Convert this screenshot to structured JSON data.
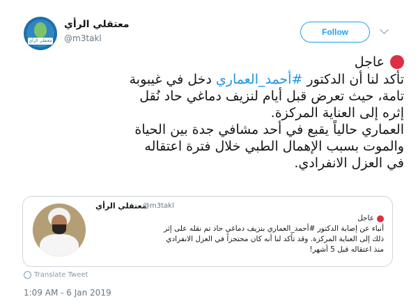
{
  "account": {
    "name": "معتقلي الرأي",
    "handle": "@m3takl",
    "avatar_label": "معتقلي الرأي"
  },
  "follow_label": "Follow",
  "tweet": {
    "urgent_label": "عاجل",
    "line1_prefix": "تأكد لنا أن الدكتور ",
    "hashtag": "#أحمد_العماري",
    "line1_suffix": " دخل في غيبوبة",
    "line2": "تامة، حيث تعرض قبل أيام لنزيف دماغي حاد نُقل",
    "line3": "إثره إلى العناية المركزة.",
    "line4": "العماري حالياً يقبع في أحد مشافي جدة بين الحياة",
    "line5": "والموت بسبب الإهمال الطبي خلال فترة اعتقاله",
    "line6": "في العزل الانفرادي."
  },
  "quoted": {
    "name": "معتقلي الرأي",
    "handle": "@m3takl",
    "urgent_label": "عاجل",
    "line1": "أنباء عن إصابة الدكتور #أحمد_العماري بنزيف دماغي حاد تم نقله على إثر",
    "line2": "ذلك إلى العناية المركزة. وقد تأكد لنا أنه كان محتجزاً في العزل الانفرادي",
    "line3": "منذ اعتقاله قبل 5 أشهر!"
  },
  "translate_label": "Translate Tweet",
  "timestamp": "1:09 AM - 6 Jan 2019",
  "colors": {
    "accent": "#1da1f2",
    "hashtag": "#1b95e0",
    "red_dot": "#dd2e44"
  }
}
